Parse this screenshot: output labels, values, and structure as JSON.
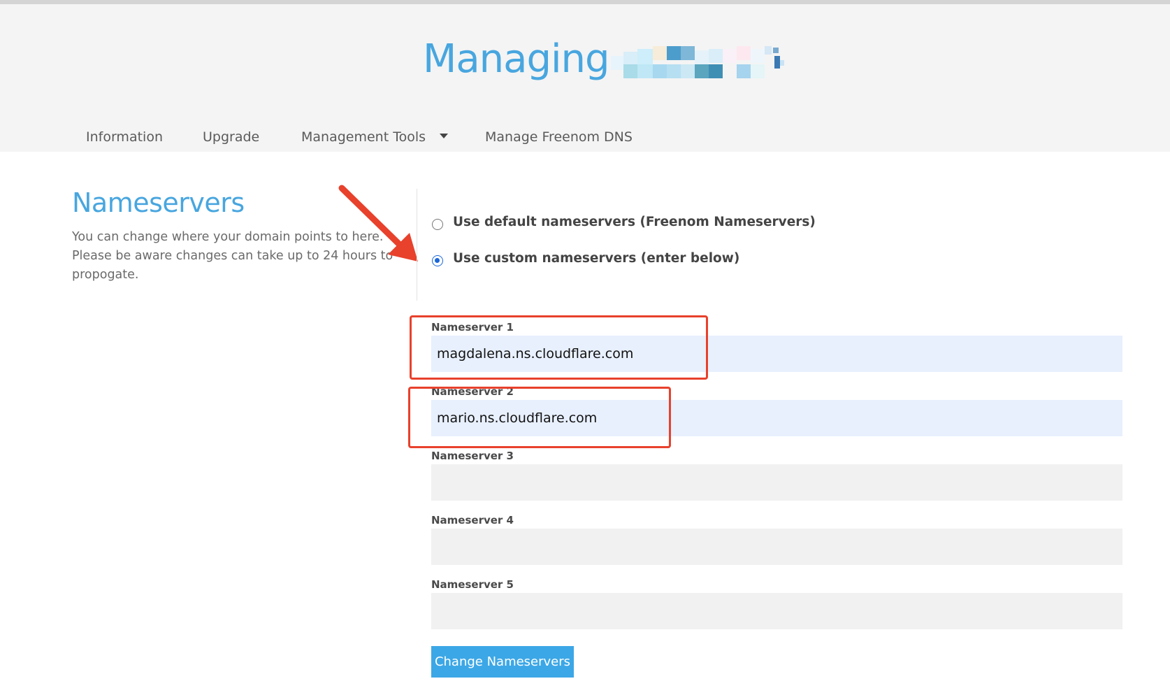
{
  "header": {
    "title": "Managing"
  },
  "nav": {
    "items": [
      {
        "label": "Information"
      },
      {
        "label": "Upgrade"
      },
      {
        "label": "Management Tools",
        "has_dropdown": true
      },
      {
        "label": "Manage Freenom DNS"
      }
    ]
  },
  "section": {
    "title": "Nameservers",
    "description": "You can change where your domain points to here. Please be aware changes can take up to 24 hours to propogate."
  },
  "options": [
    {
      "label": "Use default nameservers (Freenom Nameservers)",
      "checked": false
    },
    {
      "label": "Use custom nameservers (enter below)",
      "checked": true
    }
  ],
  "nameservers": [
    {
      "label": "Nameserver 1",
      "value": "magdalena.ns.cloudflare.com"
    },
    {
      "label": "Nameserver 2",
      "value": "mario.ns.cloudflare.com"
    },
    {
      "label": "Nameserver 3",
      "value": ""
    },
    {
      "label": "Nameserver 4",
      "value": ""
    },
    {
      "label": "Nameserver 5",
      "value": ""
    }
  ],
  "submit_label": "Change Nameservers",
  "colors": {
    "accent": "#48a6df",
    "button": "#3ca7e6",
    "annotation": "#e8412c",
    "autofill_bg": "#e8f0fe"
  }
}
